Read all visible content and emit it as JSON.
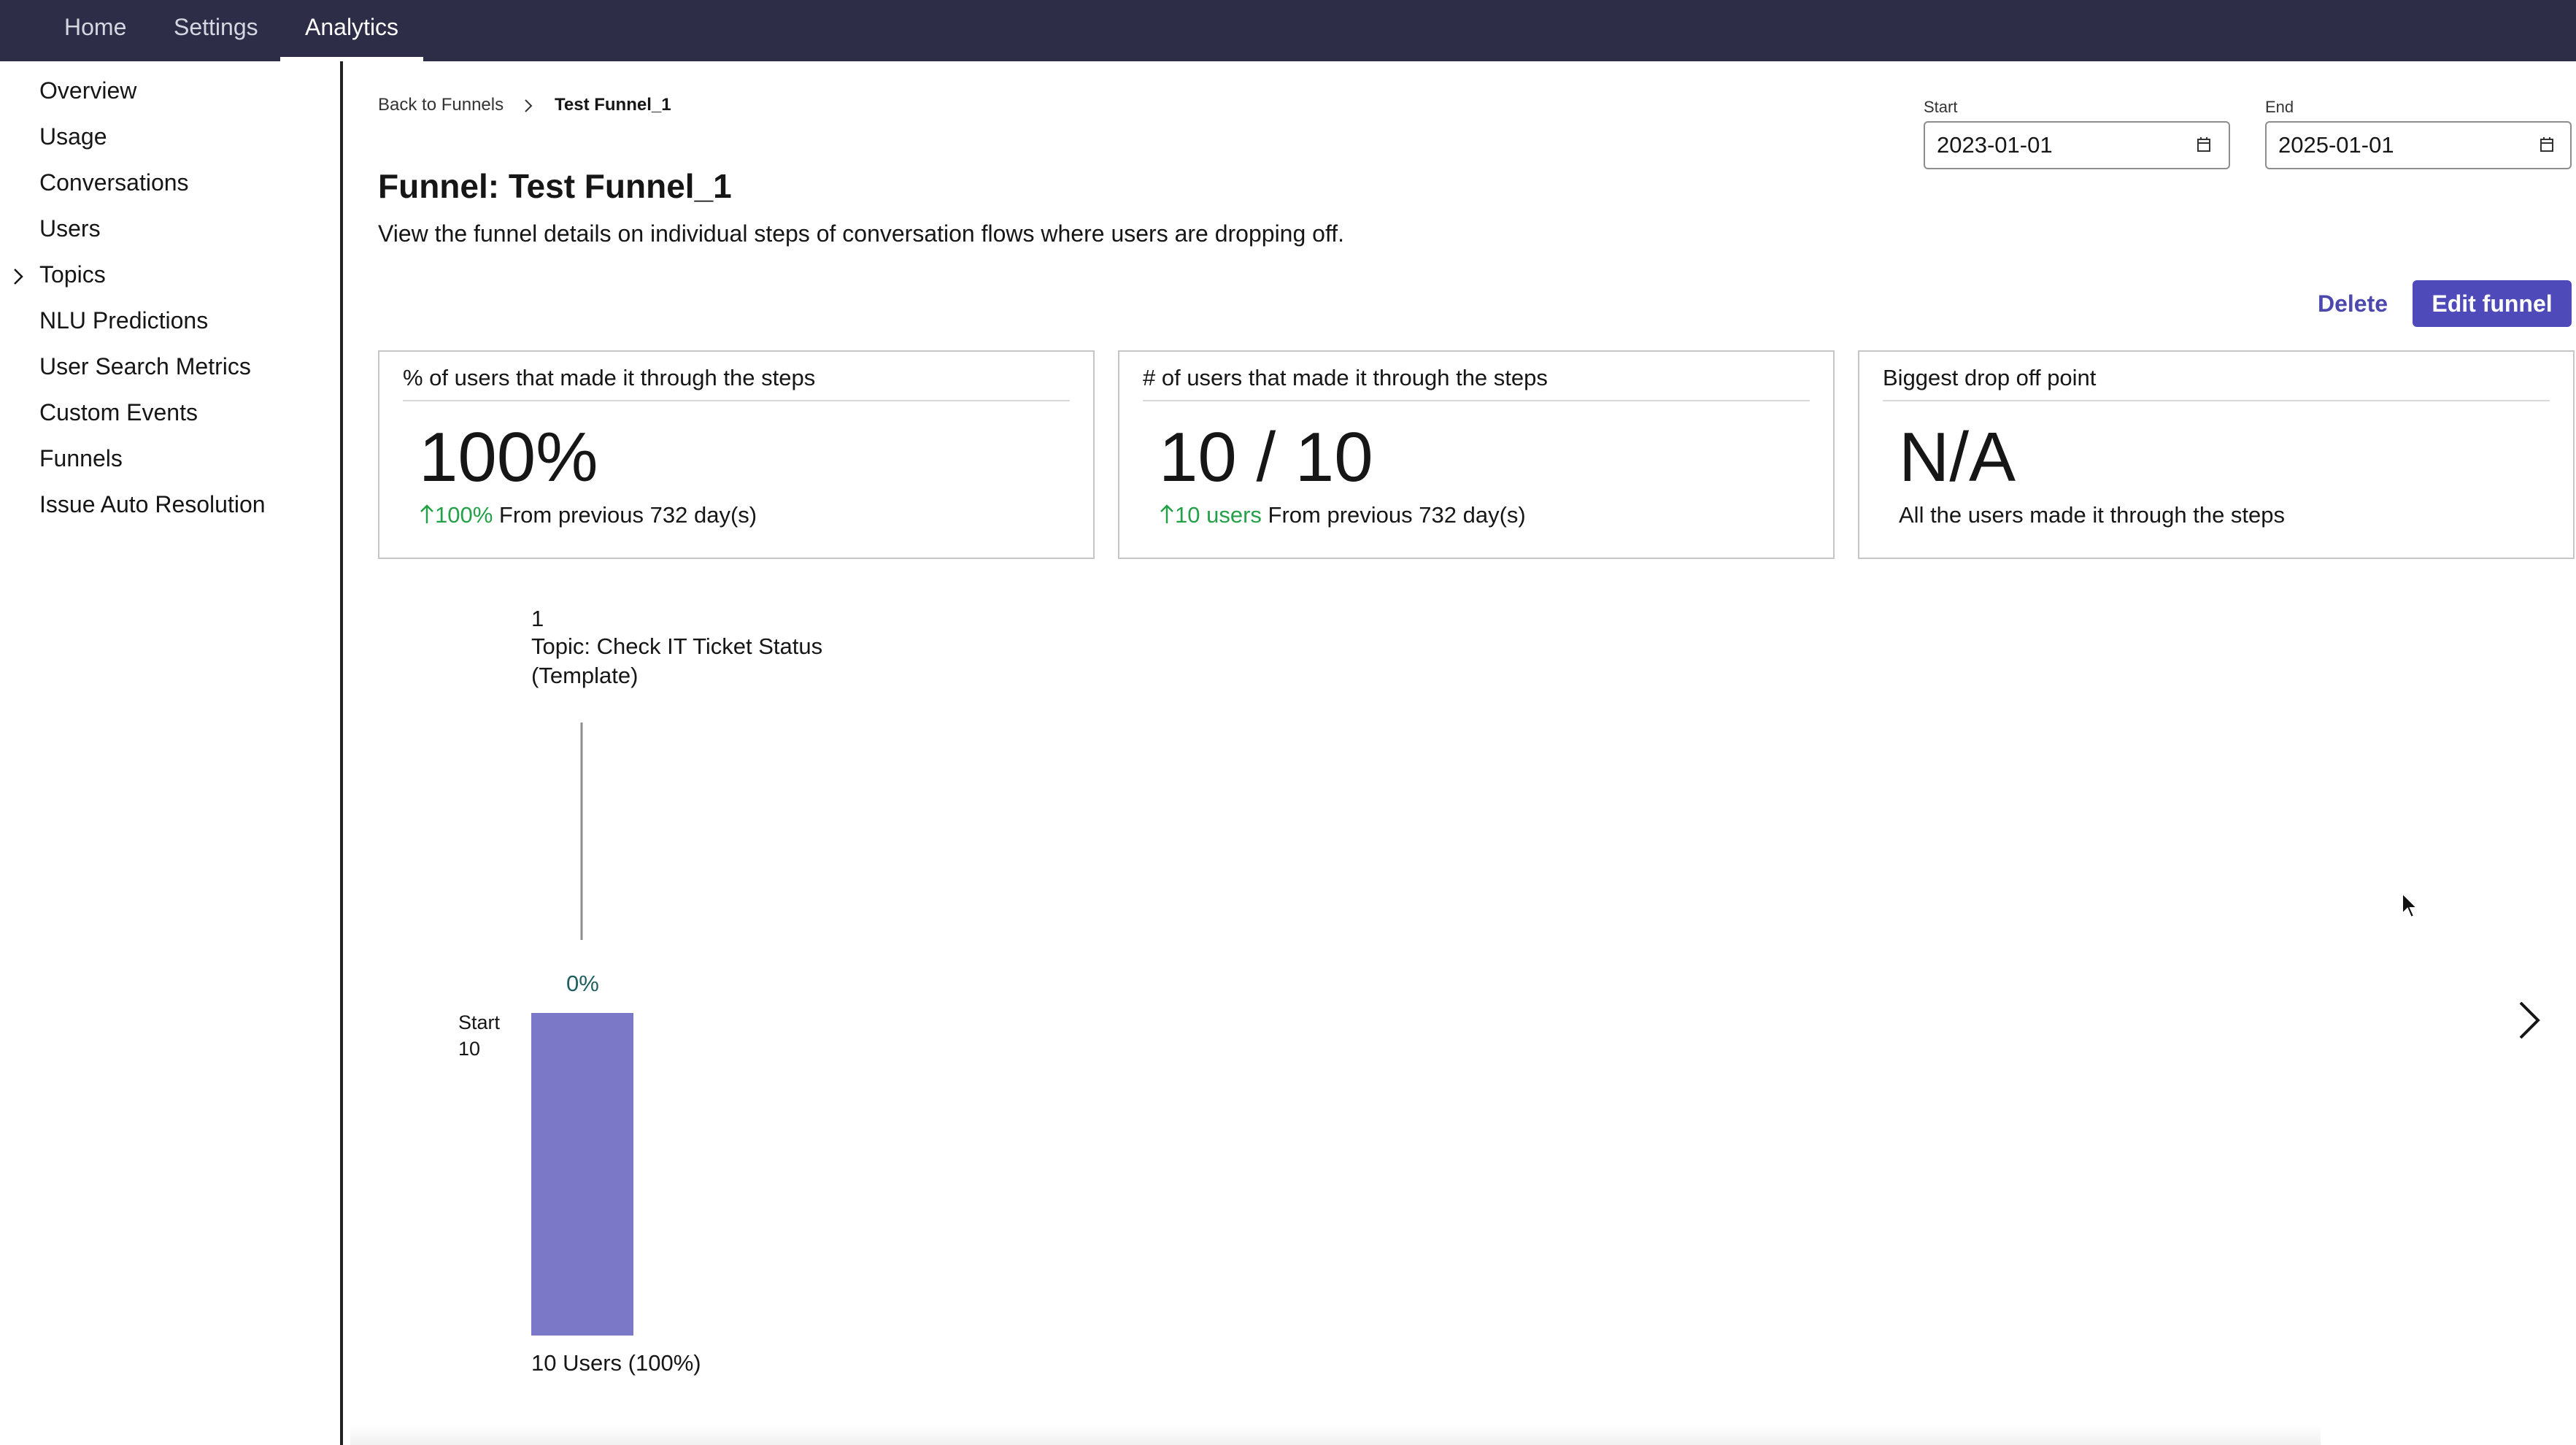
{
  "nav": {
    "tabs": [
      {
        "label": "Home"
      },
      {
        "label": "Settings"
      },
      {
        "label": "Analytics",
        "active": true
      }
    ]
  },
  "sidebar": {
    "items": [
      {
        "label": "Overview"
      },
      {
        "label": "Usage"
      },
      {
        "label": "Conversations"
      },
      {
        "label": "Users"
      },
      {
        "label": "Topics",
        "expandable": true,
        "icon": "chevron-right-icon"
      },
      {
        "label": "NLU Predictions"
      },
      {
        "label": "User Search Metrics"
      },
      {
        "label": "Custom Events"
      },
      {
        "label": "Funnels"
      },
      {
        "label": "Issue Auto Resolution"
      }
    ]
  },
  "breadcrumb": {
    "back_label": "Back to Funnels",
    "current": "Test Funnel_1"
  },
  "header": {
    "title": "Funnel: Test Funnel_1",
    "description": "View the funnel details on individual steps of conversation flows where users are dropping off."
  },
  "dates": {
    "start_label": "Start",
    "start_value": "2023-01-01",
    "end_label": "End",
    "end_value": "2025-01-01"
  },
  "actions": {
    "delete_label": "Delete",
    "edit_label": "Edit funnel"
  },
  "cards": [
    {
      "title": "% of users that made it through the steps",
      "value": "100%",
      "delta": "100%",
      "foot": "From previous 732 day(s)"
    },
    {
      "title": "# of users that made it through the steps",
      "value": "10 / 10",
      "delta": "10 users",
      "foot": "From previous 732 day(s)"
    },
    {
      "title": "Biggest drop off point",
      "value": "N/A",
      "foot": "All the users made it through the steps"
    }
  ],
  "chart_data": {
    "type": "bar",
    "categories": [
      "Topic: Check IT Ticket Status (Template)"
    ],
    "step_numbers": [
      "1"
    ],
    "values": [
      10
    ],
    "start": {
      "label": "Start",
      "count": "10"
    },
    "dropoff_labels": [
      "0%"
    ],
    "bar_labels": [
      "10 Users (100%)"
    ],
    "ylim": [
      0,
      10
    ],
    "bar_color": "#7b78c8"
  },
  "colors": {
    "nav_bg": "#2d2d47",
    "accent": "#4e4aba",
    "positive": "#24a148"
  }
}
